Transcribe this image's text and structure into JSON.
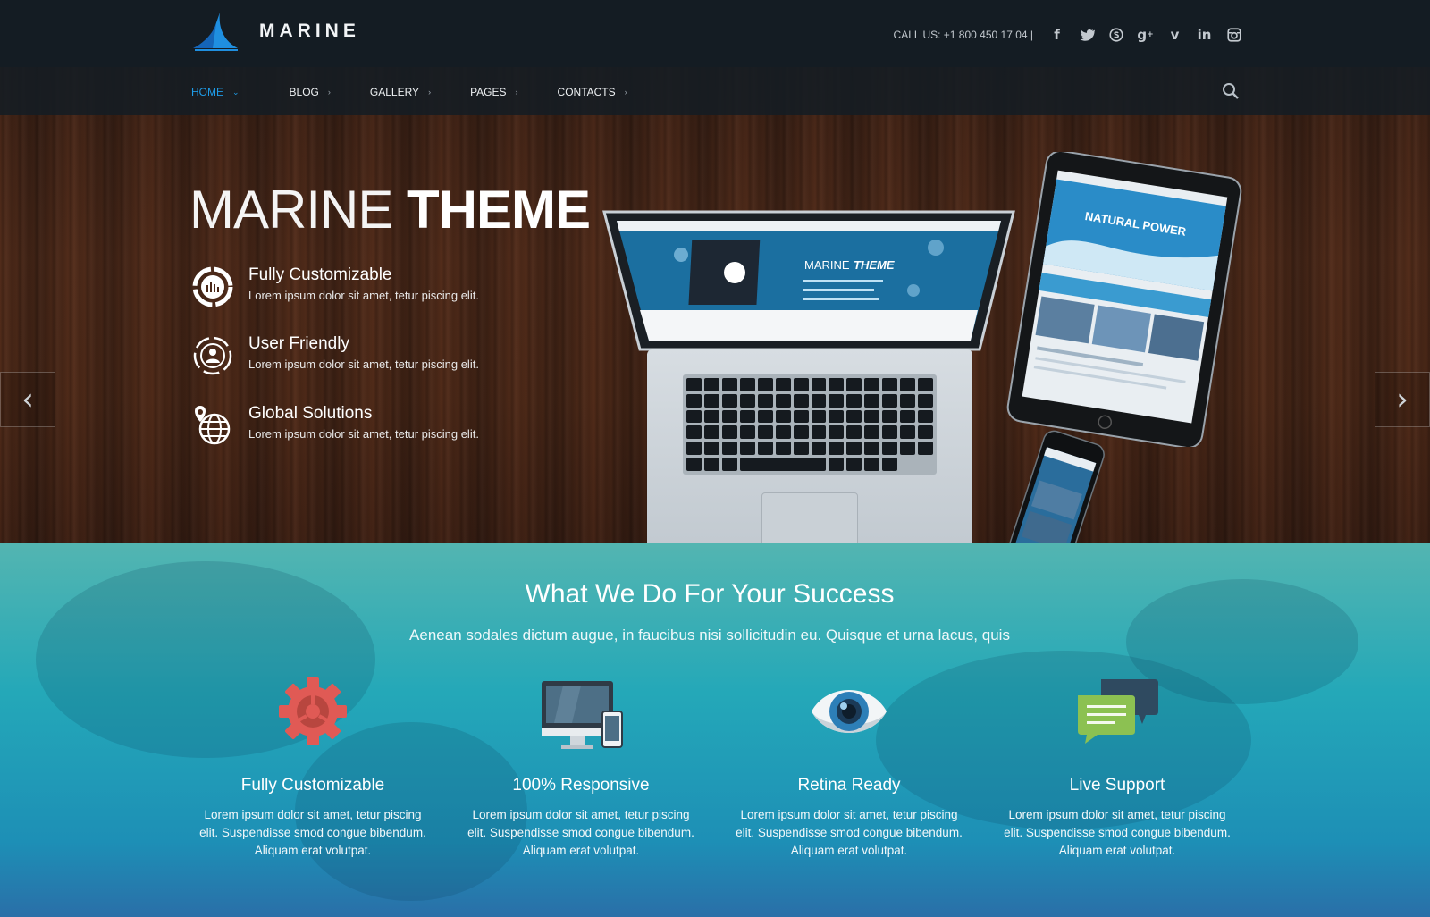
{
  "header": {
    "logo_text": "MARINE",
    "contact": "CALL US: +1 800 450 17 04   |",
    "socials": [
      "facebook-icon",
      "twitter-icon",
      "skype-icon",
      "google-plus-icon",
      "vimeo-icon",
      "linkedin-icon",
      "instagram-icon"
    ]
  },
  "nav": {
    "items": [
      {
        "label": "HOME",
        "active": true
      },
      {
        "label": "BLOG"
      },
      {
        "label": "GALLERY"
      },
      {
        "label": "PAGES"
      },
      {
        "label": "CONTACTS"
      }
    ]
  },
  "hero": {
    "title_light": "MARINE",
    "title_bold": "THEME",
    "features": [
      {
        "title": "Fully Customizable",
        "desc": "Lorem ipsum dolor sit amet, tetur piscing elit."
      },
      {
        "title": "User Friendly",
        "desc": "Lorem ipsum dolor sit amet, tetur piscing elit."
      },
      {
        "title": "Global Solutions",
        "desc": "Lorem ipsum dolor sit amet, tetur piscing elit."
      }
    ],
    "prev_glyph": "‹",
    "next_glyph": "›"
  },
  "services": {
    "title": "What We Do For Your Success",
    "subtitle": "Aenean sodales dictum augue, in faucibus nisi sollicitudin eu. Quisque et urna lacus, quis",
    "cards": [
      {
        "title": "Fully Customizable",
        "desc": "Lorem ipsum dolor sit amet, tetur piscing elit. Suspendisse smod congue bibendum. Aliquam erat volutpat.",
        "icon": "gear-icon"
      },
      {
        "title": "100% Responsive",
        "desc": "Lorem ipsum dolor sit amet, tetur piscing elit. Suspendisse smod congue bibendum. Aliquam erat volutpat.",
        "icon": "devices-icon"
      },
      {
        "title": "Retina Ready",
        "desc": "Lorem ipsum dolor sit amet, tetur piscing elit. Suspendisse smod congue bibendum. Aliquam erat volutpat.",
        "icon": "eye-icon"
      },
      {
        "title": "Live Support",
        "desc": "Lorem ipsum dolor sit amet, tetur piscing elit. Suspendisse smod congue bibendum. Aliquam erat volutpat.",
        "icon": "chat-icon"
      }
    ]
  },
  "mockups": {
    "laptop_title_light": "MARINE",
    "laptop_title_bold": "THEME",
    "tablet_title": "NATURAL POWER"
  },
  "colors": {
    "accent": "#1e9ce8",
    "topbar": "#141c23",
    "gear": "#e05a55",
    "chat_green": "#8cc152"
  }
}
